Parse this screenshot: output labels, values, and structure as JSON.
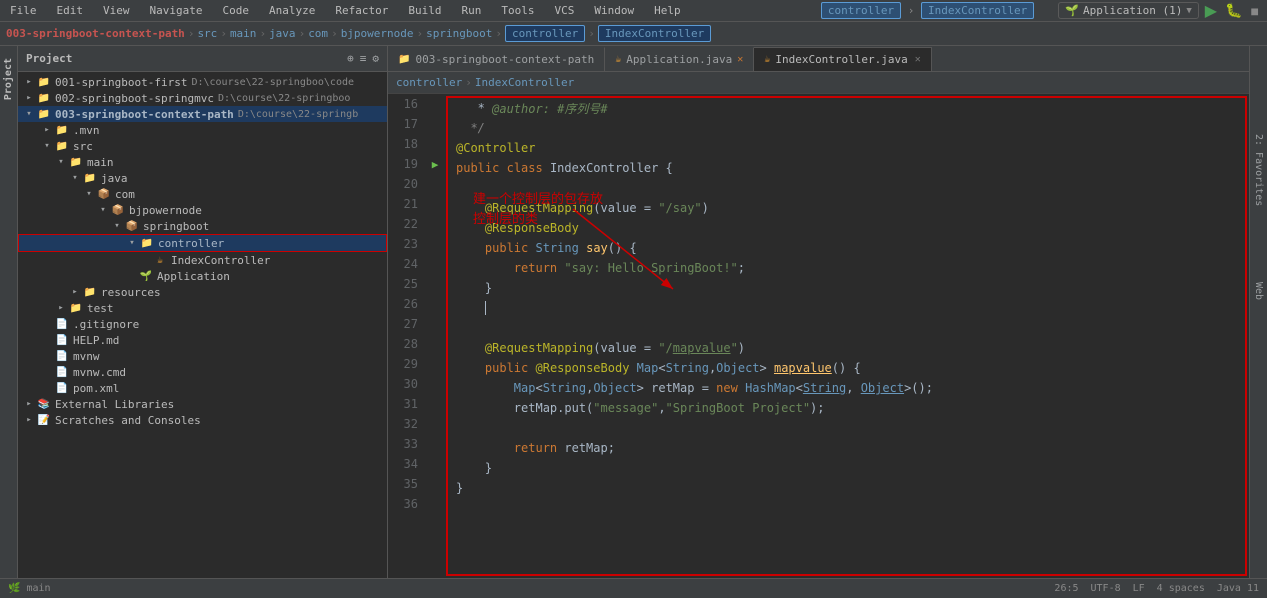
{
  "menubar": {
    "items": [
      "File",
      "Edit",
      "View",
      "Navigate",
      "Code",
      "Analyze",
      "Refactor",
      "Build",
      "Run",
      "Tools",
      "VCS",
      "Window",
      "Help"
    ]
  },
  "topPath": {
    "segments": [
      "003-springboot-context-path",
      "src",
      "main",
      "java",
      "com",
      "bjpowernode",
      "springboot",
      "controller",
      "IndexController"
    ]
  },
  "projectPanel": {
    "title": "Project",
    "tools": [
      "⊕",
      "≡",
      "⚙"
    ],
    "tree": [
      {
        "indent": 0,
        "arrow": "▸",
        "icon": "📁",
        "label": "001-springboot-first",
        "extra": "D:\\course\\22-springboo\\code"
      },
      {
        "indent": 0,
        "arrow": "▸",
        "icon": "📁",
        "label": "002-springboot-springmvc",
        "extra": "D:\\course\\22-springboo"
      },
      {
        "indent": 0,
        "arrow": "▾",
        "icon": "📁",
        "label": "003-springboot-context-path",
        "extra": "D:\\course\\22-springb",
        "bold": true
      },
      {
        "indent": 1,
        "arrow": "▸",
        "icon": "📁",
        "label": ".mvn"
      },
      {
        "indent": 1,
        "arrow": "▾",
        "icon": "📁",
        "label": "src"
      },
      {
        "indent": 2,
        "arrow": "▾",
        "icon": "📁",
        "label": "main"
      },
      {
        "indent": 3,
        "arrow": "▾",
        "icon": "📁",
        "label": "java"
      },
      {
        "indent": 4,
        "arrow": "▾",
        "icon": "📦",
        "label": "com"
      },
      {
        "indent": 5,
        "arrow": "▾",
        "icon": "📦",
        "label": "bjpowernode"
      },
      {
        "indent": 6,
        "arrow": "▾",
        "icon": "📦",
        "label": "springboot"
      },
      {
        "indent": 7,
        "arrow": "▾",
        "icon": "📁",
        "label": "controller",
        "highlighted": true
      },
      {
        "indent": 8,
        "arrow": " ",
        "icon": "☕",
        "label": "IndexController"
      },
      {
        "indent": 7,
        "arrow": " ",
        "icon": "🌱",
        "label": "Application"
      },
      {
        "indent": 3,
        "arrow": "▸",
        "icon": "📁",
        "label": "resources"
      },
      {
        "indent": 1,
        "arrow": "▸",
        "icon": "📁",
        "label": "test"
      },
      {
        "indent": 1,
        "arrow": " ",
        "icon": "📄",
        "label": ".gitignore"
      },
      {
        "indent": 1,
        "arrow": " ",
        "icon": "📄",
        "label": "HELP.md"
      },
      {
        "indent": 1,
        "arrow": " ",
        "icon": "📄",
        "label": "mvnw"
      },
      {
        "indent": 1,
        "arrow": " ",
        "icon": "📄",
        "label": "mvnw.cmd"
      },
      {
        "indent": 1,
        "arrow": " ",
        "icon": "📄",
        "label": "pom.xml"
      },
      {
        "indent": 0,
        "arrow": "▸",
        "icon": "📚",
        "label": "External Libraries"
      },
      {
        "indent": 0,
        "arrow": "▸",
        "icon": "📝",
        "label": "Scratches and Consoles"
      }
    ]
  },
  "editorTabs": [
    {
      "label": "003-springboot-context-path",
      "active": false,
      "icon": "📁"
    },
    {
      "label": "Application.java",
      "active": false,
      "icon": "☕",
      "modified": true
    },
    {
      "label": "IndexController.java",
      "active": true,
      "icon": "☕"
    }
  ],
  "breadcrumbs": {
    "items": [
      "controller",
      "IndexController"
    ]
  },
  "codeLines": [
    {
      "num": 16,
      "content": "  * <span class='comment'>@author: #序列号#</span>"
    },
    {
      "num": 17,
      "content": "  <span class='comment'>*/</span>"
    },
    {
      "num": 18,
      "content": "<span class='annotation'>@Controller</span>"
    },
    {
      "num": 19,
      "content": "<span class='kw'>public</span> <span class='kw'>class</span> <span class='class-name'>IndexController</span> {",
      "hasGutter": true
    },
    {
      "num": 20,
      "content": ""
    },
    {
      "num": 21,
      "content": "    <span class='annotation'>@RequestMapping</span>(value = <span class='string'>\"/say\"</span>)"
    },
    {
      "num": 22,
      "content": "    <span class='annotation'>@ResponseBody</span>"
    },
    {
      "num": 23,
      "content": "    <span class='kw'>public</span> <span class='type'>String</span> <span class='method'>say</span>() {"
    },
    {
      "num": 24,
      "content": "        <span class='kw'>return</span> <span class='string'>\"say: Hello SpringBoot!\"</span>;"
    },
    {
      "num": 25,
      "content": "    }"
    },
    {
      "num": 26,
      "content": "    <span class='plain'>|</span>"
    },
    {
      "num": 27,
      "content": ""
    },
    {
      "num": 28,
      "content": "    <span class='annotation'>@RequestMapping</span>(value = <span class='string'>\"/<span class='underline'>mapvalue</span>\"</span>)"
    },
    {
      "num": 29,
      "content": "    <span class='kw'>public</span> <span class='annotation'>@ResponseBody</span> <span class='type'>Map</span>&lt;<span class='type'>String</span>,<span class='type'>Object</span>&gt; <span class='method underline'>mapvalue</span>() {"
    },
    {
      "num": 30,
      "content": "        <span class='type'>Map</span>&lt;<span class='type'>String</span>,<span class='type'>Object</span>&gt; retMap = <span class='kw'>new</span> <span class='type'>HashMap</span>&lt;<span class='type underline'>String</span>, <span class='type underline'>Object</span>&gt;();"
    },
    {
      "num": 31,
      "content": "        retMap.put(<span class='string'>\"message\"</span>,<span class='string'>\"SpringBoot Project\"</span>);"
    },
    {
      "num": 32,
      "content": ""
    },
    {
      "num": 33,
      "content": "        <span class='kw'>return</span> retMap;"
    },
    {
      "num": 34,
      "content": "    }"
    },
    {
      "num": 35,
      "content": "}"
    },
    {
      "num": 36,
      "content": ""
    }
  ],
  "annotation": {
    "text": "建一个控制层的包存放\n控制层的类",
    "color": "#cc0000"
  },
  "runConfig": {
    "label": "Application (1)"
  },
  "statusBar": {
    "line": "26:5",
    "encoding": "UTF-8",
    "lineEnding": "LF",
    "indent": "4 spaces"
  }
}
